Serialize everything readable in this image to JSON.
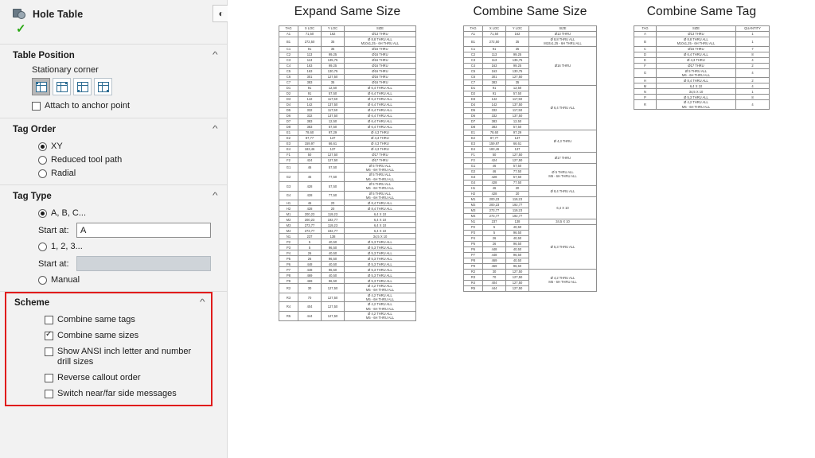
{
  "panel": {
    "title": "Hole Table",
    "icon": "hole-table-icon",
    "help_icon": "help-circle-icon",
    "ok_mark": "✓",
    "sections": {
      "table_position": {
        "title": "Table Position",
        "collapse_icon": "chevron-up-icon",
        "stationary_corner_label": "Stationary corner",
        "corners": [
          {
            "name": "corner-top-left",
            "selected": true
          },
          {
            "name": "corner-top-right",
            "selected": false
          },
          {
            "name": "corner-bottom-left",
            "selected": false
          },
          {
            "name": "corner-bottom-right",
            "selected": false
          }
        ],
        "attach_anchor": {
          "label": "Attach to anchor point",
          "checked": false
        }
      },
      "tag_order": {
        "title": "Tag Order",
        "collapse_icon": "chevron-up-icon",
        "options": [
          {
            "label": "XY",
            "selected": true
          },
          {
            "label": "Reduced tool path",
            "selected": false
          },
          {
            "label": "Radial",
            "selected": false
          }
        ]
      },
      "tag_type": {
        "title": "Tag Type",
        "collapse_icon": "chevron-up-icon",
        "alpha": {
          "label": "A, B, C...",
          "selected": true
        },
        "alpha_start_label": "Start at:",
        "alpha_start_value": "A",
        "numeric": {
          "label": "1, 2, 3...",
          "selected": false
        },
        "numeric_start_label": "Start at:",
        "numeric_start_value": "",
        "manual": {
          "label": "Manual",
          "selected": false
        }
      },
      "scheme": {
        "title": "Scheme",
        "collapse_icon": "chevron-up-icon",
        "highlight_color": "#e01b1b",
        "options": [
          {
            "label": "Combine same tags",
            "checked": false
          },
          {
            "label": "Combine same sizes",
            "checked": true
          },
          {
            "label": "Show ANSI inch letter and number drill sizes",
            "checked": false
          },
          {
            "label": "Reverse callout order",
            "checked": false
          },
          {
            "label": "Switch near/far side messages",
            "checked": false
          }
        ]
      }
    }
  },
  "tables": [
    {
      "title": "Expand Same Size",
      "headers": [
        "TAG",
        "X LOC",
        "Y LOC",
        "SIZE"
      ],
      "rows": [
        [
          "A1",
          "71,50",
          "162",
          "Ø13 THRU"
        ],
        [
          "B1",
          "272,50",
          "35",
          "Ø 8,8 THRU ALL\nM10x1,25 - 6H THRU ALL"
        ],
        [
          "C1",
          "91",
          "35",
          "Ø16 THRU"
        ],
        [
          "C2",
          "113",
          "99,25",
          "Ø16 THRU"
        ],
        [
          "C3",
          "113",
          "135,75",
          "Ø16 THRU"
        ],
        [
          "C4",
          "163",
          "99,25",
          "Ø16 THRU"
        ],
        [
          "C5",
          "163",
          "130,75",
          "Ø16 THRU"
        ],
        [
          "C6",
          "301",
          "127,50",
          "Ø16 THRU"
        ],
        [
          "C7",
          "383",
          "35",
          "Ø16 THRU"
        ],
        [
          "D1",
          "91",
          "12,50",
          "Ø 6,4 THRU ALL"
        ],
        [
          "D2",
          "91",
          "57,50",
          "Ø 6,4 THRU ALL"
        ],
        [
          "D3",
          "142",
          "117,50",
          "Ø 6,4 THRU ALL"
        ],
        [
          "D4",
          "142",
          "137,50",
          "Ø 6,4 THRU ALL"
        ],
        [
          "D5",
          "332",
          "117,50",
          "Ø 6,4 THRU ALL"
        ],
        [
          "D6",
          "332",
          "137,50",
          "Ø 6,4 THRU ALL"
        ],
        [
          "D7",
          "383",
          "12,50",
          "Ø 6,4 THRU ALL"
        ],
        [
          "D8",
          "383",
          "57,50",
          "Ø 6,4 THRU ALL"
        ],
        [
          "E1",
          "78,60",
          "97,29",
          "Ø 4,3 THRU"
        ],
        [
          "E2",
          "87,77",
          "137",
          "Ø 4,3 THRU"
        ],
        [
          "E3",
          "159,97",
          "66,61",
          "Ø 4,3 THRU"
        ],
        [
          "E4",
          "183,46",
          "137",
          "Ø 4,3 THRU"
        ],
        [
          "F1",
          "50",
          "127,50",
          "Ø17 THRU"
        ],
        [
          "F2",
          "424",
          "127,50",
          "Ø17 THRU"
        ],
        [
          "G1",
          "46",
          "57,50",
          "Ø 5 THRU ALL\nM6 - 6H THRU ALL"
        ],
        [
          "G2",
          "46",
          "77,50",
          "Ø 5 THRU ALL\nM6 - 6H THRU ALL"
        ],
        [
          "G3",
          "428",
          "57,50",
          "Ø 5 THRU ALL\nM6 - 6H THRU ALL"
        ],
        [
          "G4",
          "428",
          "77,50",
          "Ø 5 THRU ALL\nM6 - 6H THRU ALL"
        ],
        [
          "H1",
          "46",
          "20",
          "Ø 8,4 THRU ALL"
        ],
        [
          "H2",
          "428",
          "20",
          "Ø 8,4 THRU ALL"
        ],
        [
          "M1",
          "200,23",
          "119,23",
          "6,4 X 10"
        ],
        [
          "M2",
          "200,23",
          "192,77",
          "6,4 X 10"
        ],
        [
          "M3",
          "273,77",
          "119,23",
          "6,4 X 10"
        ],
        [
          "M4",
          "273,77",
          "192,77",
          "6,4 X 10"
        ],
        [
          "N1",
          "237",
          "138",
          "34,5 X 10"
        ],
        [
          "P2",
          "5",
          "40,50",
          "Ø 5,3 THRU ALL"
        ],
        [
          "P3",
          "5",
          "96,50",
          "Ø 5,3 THRU ALL"
        ],
        [
          "P4",
          "26",
          "40,50",
          "Ø 5,3 THRU ALL"
        ],
        [
          "P5",
          "26",
          "96,50",
          "Ø 5,3 THRU ALL"
        ],
        [
          "P6",
          "448",
          "40,50",
          "Ø 5,3 THRU ALL"
        ],
        [
          "P7",
          "448",
          "96,50",
          "Ø 5,3 THRU ALL"
        ],
        [
          "P8",
          "469",
          "40,50",
          "Ø 5,3 THRU ALL"
        ],
        [
          "P9",
          "469",
          "96,50",
          "Ø 5,3 THRU ALL"
        ],
        [
          "R2",
          "30",
          "127,50",
          "Ø 4,2 THRU ALL\nM5 - 6H THRU ALL"
        ],
        [
          "R3",
          "70",
          "127,50",
          "Ø 4,2 THRU ALL\nM5 - 6H THRU ALL"
        ],
        [
          "R4",
          "404",
          "127,50",
          "Ø 4,2 THRU ALL\nM5 - 6H THRU ALL"
        ],
        [
          "R5",
          "444",
          "127,50",
          "Ø 4,2 THRU ALL\nM5 - 6H THRU ALL"
        ]
      ]
    },
    {
      "title": "Combine Same Size",
      "headers": [
        "TAG",
        "X LOC",
        "Y LOC",
        "SIZE"
      ],
      "rows": [
        [
          "A1",
          "71,50",
          "162"
        ],
        [
          "B1",
          "272,50",
          "35"
        ],
        [
          "C1",
          "91",
          "35"
        ],
        [
          "C2",
          "113",
          "99,25"
        ],
        [
          "C3",
          "113",
          "135,75"
        ],
        [
          "C4",
          "163",
          "99,25"
        ],
        [
          "C5",
          "163",
          "130,75"
        ],
        [
          "C6",
          "301",
          "127,50"
        ],
        [
          "C7",
          "383",
          "35"
        ],
        [
          "D1",
          "91",
          "12,50"
        ],
        [
          "D2",
          "91",
          "57,50"
        ],
        [
          "D3",
          "142",
          "117,50"
        ],
        [
          "D4",
          "142",
          "137,50"
        ],
        [
          "D5",
          "332",
          "117,50"
        ],
        [
          "D6",
          "332",
          "137,50"
        ],
        [
          "D7",
          "383",
          "12,50"
        ],
        [
          "D8",
          "383",
          "57,50"
        ],
        [
          "E1",
          "78,60",
          "97,29"
        ],
        [
          "E2",
          "87,77",
          "137"
        ],
        [
          "E3",
          "159,97",
          "66,61"
        ],
        [
          "E4",
          "183,46",
          "137"
        ],
        [
          "F1",
          "50",
          "127,50"
        ],
        [
          "F2",
          "424",
          "127,50"
        ],
        [
          "G1",
          "46",
          "57,50"
        ],
        [
          "G2",
          "46",
          "77,50"
        ],
        [
          "G3",
          "428",
          "57,50"
        ],
        [
          "G4",
          "428",
          "77,50"
        ],
        [
          "H1",
          "46",
          "20"
        ],
        [
          "H2",
          "428",
          "20"
        ],
        [
          "M1",
          "200,23",
          "119,23"
        ],
        [
          "M2",
          "200,23",
          "192,77"
        ],
        [
          "M3",
          "273,77",
          "119,23"
        ],
        [
          "M4",
          "273,77",
          "192,77"
        ],
        [
          "N1",
          "237",
          "138"
        ],
        [
          "P2",
          "5",
          "40,50"
        ],
        [
          "P3",
          "5",
          "96,50"
        ],
        [
          "P4",
          "26",
          "40,50"
        ],
        [
          "P5",
          "26",
          "96,50"
        ],
        [
          "P6",
          "448",
          "40,50"
        ],
        [
          "P7",
          "448",
          "96,50"
        ],
        [
          "P8",
          "469",
          "40,50"
        ],
        [
          "P9",
          "469",
          "96,50"
        ],
        [
          "R2",
          "30",
          "127,50"
        ],
        [
          "R3",
          "70",
          "127,50"
        ],
        [
          "R4",
          "404",
          "127,50"
        ],
        [
          "R5",
          "444",
          "127,50"
        ]
      ],
      "size_groups": [
        {
          "size": "Ø13 THRU",
          "span": 1
        },
        {
          "size": "Ø 8,8 THRU ALL\nM10x1,25 - 6H THRU ALL",
          "span": 1
        },
        {
          "size": "Ø16 THRU",
          "span": 7
        },
        {
          "size": "Ø 6,4 THRU ALL",
          "span": 8
        },
        {
          "size": "Ø 4,3 THRU",
          "span": 4
        },
        {
          "size": "Ø17 THRU",
          "span": 2
        },
        {
          "size": "Ø 5 THRU ALL\nM6 - 6H THRU ALL",
          "span": 4
        },
        {
          "size": "Ø 8,4 THRU ALL",
          "span": 2
        },
        {
          "size": "6,4 X 10",
          "span": 4
        },
        {
          "size": "34,5 X 10",
          "span": 1
        },
        {
          "size": "Ø 5,3 THRU ALL",
          "span": 8
        },
        {
          "size": "Ø 4,2 THRU ALL\nM5 - 6H THRU ALL",
          "span": 4
        }
      ]
    },
    {
      "title": "Combine Same Tag",
      "headers": [
        "TAG",
        "SIZE",
        "QUANTITY"
      ],
      "rows": [
        [
          "A",
          "Ø13 THRU",
          "1"
        ],
        [
          "B",
          "Ø 8,8 THRU ALL\nM10x1,25 - 6H THRU ALL",
          "1"
        ],
        [
          "C",
          "Ø16 THRU",
          "7"
        ],
        [
          "D",
          "Ø 6,4 THRU ALL",
          "8"
        ],
        [
          "E",
          "Ø 4,3 THRU",
          "4"
        ],
        [
          "F",
          "Ø17 THRU",
          "2"
        ],
        [
          "G",
          "Ø 5 THRU ALL\nM6 - 6H THRU ALL",
          "4"
        ],
        [
          "H",
          "Ø 8,4 THRU ALL",
          "2"
        ],
        [
          "M",
          "6,4 X 10",
          "4"
        ],
        [
          "N",
          "34,5 X 10",
          "1"
        ],
        [
          "P",
          "Ø 5,3 THRU ALL",
          "8"
        ],
        [
          "R",
          "Ø 4,2 THRU ALL\nM5 - 6H THRU ALL",
          "4"
        ]
      ]
    }
  ]
}
